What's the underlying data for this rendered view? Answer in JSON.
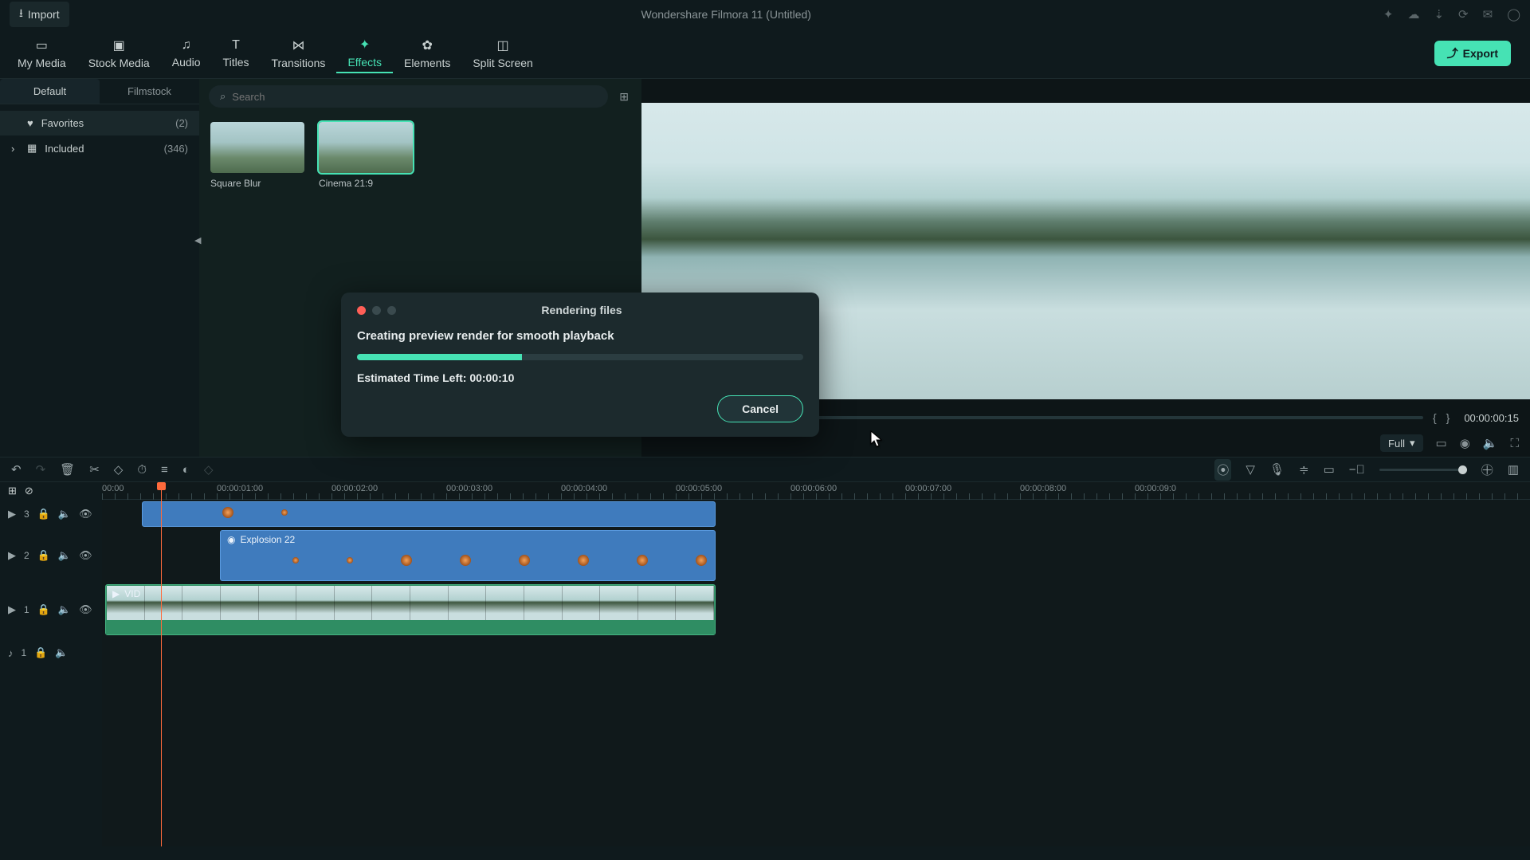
{
  "titlebar": {
    "import_label": "Import",
    "app_title": "Wondershare Filmora 11 (Untitled)"
  },
  "primary_tabs": {
    "my_media": "My Media",
    "stock_media": "Stock Media",
    "audio": "Audio",
    "titles": "Titles",
    "transitions": "Transitions",
    "effects": "Effects",
    "elements": "Elements",
    "split_screen": "Split Screen",
    "active": "effects",
    "export_label": "Export"
  },
  "subtabs": {
    "default": "Default",
    "filmstock": "Filmstock",
    "active": "default"
  },
  "sidebar": {
    "favorites": {
      "label": "Favorites",
      "count": "(2)"
    },
    "included": {
      "label": "Included",
      "count": "(346)"
    }
  },
  "search": {
    "placeholder": "Search"
  },
  "thumbs": {
    "0": {
      "label": "Square Blur"
    },
    "1": {
      "label": "Cinema 21:9"
    },
    "selected": 1
  },
  "preview": {
    "timecode": "00:00:00:15",
    "quality": "Full"
  },
  "dialog": {
    "title": "Rendering files",
    "message": "Creating preview render for smooth playback",
    "eta": "Estimated Time Left: 00:00:10",
    "cancel": "Cancel",
    "progress_pct": 37
  },
  "timeline": {
    "ruler": [
      "00:00",
      "00:00:01:00",
      "00:00:02:00",
      "00:00:03:00",
      "00:00:04:00",
      "00:00:05:00",
      "00:00:06:00",
      "00:00:07:00",
      "00:00:08:00",
      "00:00:09:0"
    ],
    "track3": {
      "id": "3"
    },
    "track2": {
      "id": "2",
      "clip_label": "Explosion 22"
    },
    "track1": {
      "id": "1",
      "clip_label": "VID"
    },
    "audio1": {
      "id": "1"
    }
  },
  "colors": {
    "accent": "#46e2b4",
    "bg": "#0f1a1d"
  }
}
